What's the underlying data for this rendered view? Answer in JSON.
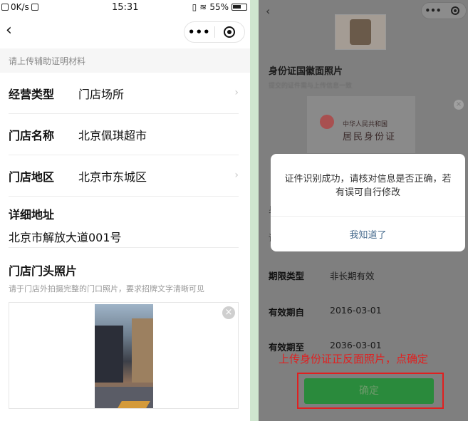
{
  "left": {
    "status_bar": {
      "speed": "0K/s",
      "time": "15:31",
      "battery": "55%"
    },
    "hint": "请上传辅助证明材料",
    "rows": [
      {
        "label": "经营类型",
        "value": "门店场所",
        "chevron": "›"
      },
      {
        "label": "门店名称",
        "value": "北京佩琪超市"
      },
      {
        "label": "门店地区",
        "value": "北京市东城区",
        "chevron": "›"
      }
    ],
    "address": {
      "label": "详细地址",
      "value": "北京市解放大道001号"
    },
    "photo": {
      "title": "门店门头照片",
      "hint": "请于门店外拍摄完整的门口照片，要求招牌文字清晰可见",
      "close": "×"
    },
    "nav": {
      "back": "‹",
      "more": "•••"
    }
  },
  "right": {
    "nav": {
      "back": "‹",
      "more": "•••"
    },
    "id_section_title": "身份证国徽面照片",
    "id_section_hint": "提交的证件需与上传信息一致",
    "id_card": {
      "line1": "中华人民共和国",
      "line2": "居民身份证"
    },
    "card_close": "×",
    "dialog": {
      "message": "证件识别成功，请核对信息是否正确，若有误可自行修改",
      "button": "我知道了"
    },
    "hidden_markers": [
      "身",
      "证"
    ],
    "fields": [
      {
        "label": "期限类型",
        "value": "非长期有效"
      },
      {
        "label": "有效期自",
        "value": "2016-03-01"
      },
      {
        "label": "有效期至",
        "value": "2036-03-01"
      }
    ],
    "annotation": "上传身份证正反面照片，点确定",
    "confirm_button": "确定",
    "colors": {
      "annotation": "#e02020",
      "confirm": "#2a8a3c"
    }
  }
}
